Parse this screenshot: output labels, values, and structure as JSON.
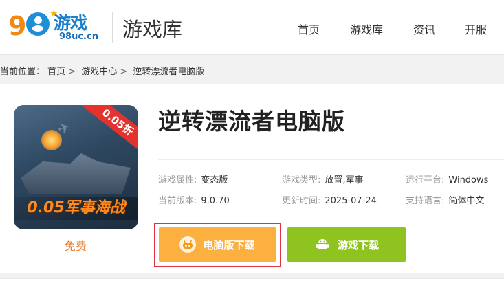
{
  "header": {
    "logo_text": "游戏",
    "logo_number": "98",
    "logo_domain": "98uc.cn",
    "section_title": "游戏库",
    "nav": [
      "首页",
      "游戏库",
      "资讯",
      "开服"
    ]
  },
  "breadcrumb": {
    "label": "当前位置：",
    "items": [
      "首页",
      "游戏中心",
      "逆转漂流者电脑版"
    ],
    "separator": ">"
  },
  "game": {
    "title": "逆转漂流者电脑版",
    "price": "免费",
    "icon_badge": "0.05折",
    "icon_banner": "0.05军事海战",
    "meta": [
      {
        "label": "游戏属性:",
        "value": "变态版"
      },
      {
        "label": "游戏类型:",
        "value": "放置,军事"
      },
      {
        "label": "运行平台:",
        "value": "Windows"
      },
      {
        "label": "当前版本:",
        "value": "9.0.70"
      },
      {
        "label": "更新时间:",
        "value": "2025-07-24"
      },
      {
        "label": "支持语言:",
        "value": "简体中文"
      }
    ]
  },
  "buttons": {
    "pc_download": "电脑版下载",
    "game_download": "游戏下载"
  },
  "colors": {
    "pc_button": "#fcb040",
    "game_button": "#8fc31f",
    "highlight_border": "#e0333f",
    "price": "#e57b2e"
  }
}
